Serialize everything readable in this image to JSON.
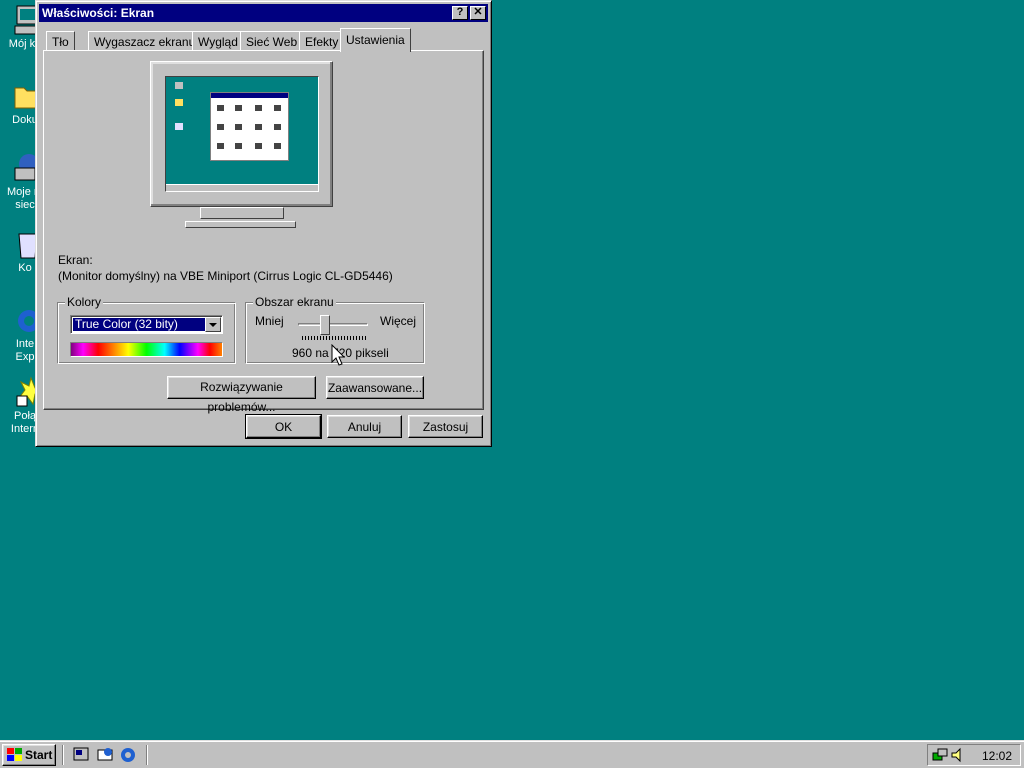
{
  "desktop": {
    "icons": [
      {
        "name": "my-computer-icon",
        "label": "Mój ko"
      },
      {
        "name": "my-documents-icon",
        "label": "Doku"
      },
      {
        "name": "network-places-icon",
        "label1": "Moje m",
        "label2": "siec"
      },
      {
        "name": "recycle-bin-icon",
        "label": "Ko"
      },
      {
        "name": "internet-explorer-icon",
        "label1": "Inte",
        "label2": "Exp"
      },
      {
        "name": "internet-connection-icon",
        "label1": "Połą",
        "label2": "Intern"
      }
    ]
  },
  "dialog": {
    "title": "Właściwości: Ekran",
    "help_btn": "?",
    "close_btn": "✕",
    "tabs": [
      "Tło",
      "Wygaszacz ekranu",
      "Wygląd",
      "Sieć Web",
      "Efekty",
      "Ustawienia"
    ],
    "active_tab": "Ustawienia",
    "display_label": "Ekran:",
    "display_value": "(Monitor domyślny) na VBE Miniport (Cirrus Logic CL-GD5446)",
    "colors": {
      "label": "Kolory",
      "selected": "True Color (32 bity)"
    },
    "screen_area": {
      "label": "Obszar ekranu",
      "less": "Mniej",
      "more": "Więcej",
      "resolution": "960 na 720 pikseli"
    },
    "troubleshoot_btn": "Rozwiązywanie problemów...",
    "advanced_btn": "Zaawansowane...",
    "ok_btn": "OK",
    "cancel_btn": "Anuluj",
    "apply_btn": "Zastosuj"
  },
  "taskbar": {
    "start_label": "Start",
    "clock": "12:02"
  }
}
